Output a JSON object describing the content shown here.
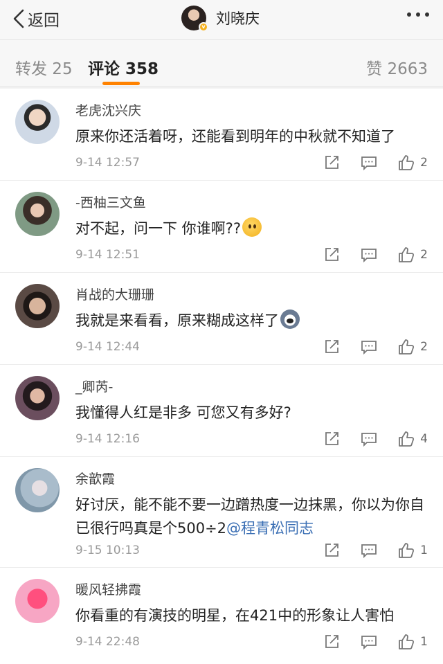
{
  "nav": {
    "back_label": "返回",
    "title": "刘晓庆",
    "badge": "v"
  },
  "tabs": {
    "repost": "转发 25",
    "comments": "评论 358",
    "likes": "赞 2663",
    "active_color": "#ff8200"
  },
  "comments": [
    {
      "user": "老虎沈兴庆",
      "text": "原来你还活着呀，还能看到明年的中秋就不知道了",
      "time": "9-14 12:57",
      "likes": "2",
      "avatar_color": "#dfe6ee"
    },
    {
      "user": "-西柚三文鱼",
      "text": "对不起，问一下 你谁啊??",
      "emoji": "thinking-face",
      "time": "9-14 12:51",
      "likes": "2",
      "avatar_color": "#6f8a74"
    },
    {
      "user": "肖战的大珊珊",
      "text": "我就是来看看，原来糊成这样了",
      "emoji": "doge",
      "time": "9-14 12:44",
      "likes": "2",
      "avatar_color": "#4a3a35"
    },
    {
      "user": "_卿芮-",
      "text": "我懂得人红是非多 可您又有多好?",
      "time": "9-14 12:16",
      "likes": "4",
      "avatar_color": "#3a2d3a"
    },
    {
      "user": "余歆霞",
      "text": "好讨厌，能不能不要一边蹭热度一边抹黑，你以为你自已很行吗真是个500÷2",
      "mention": "@程青松同志",
      "time": "9-15 10:13",
      "likes": "1",
      "avatar_color": "#9fb7c9"
    },
    {
      "user": "暖风轻拂霞",
      "text": "你看重的有演技的明星，在421中的形象让人害怕",
      "time": "9-14 22:48",
      "likes": "1",
      "avatar_color": "#f06aa0"
    }
  ]
}
